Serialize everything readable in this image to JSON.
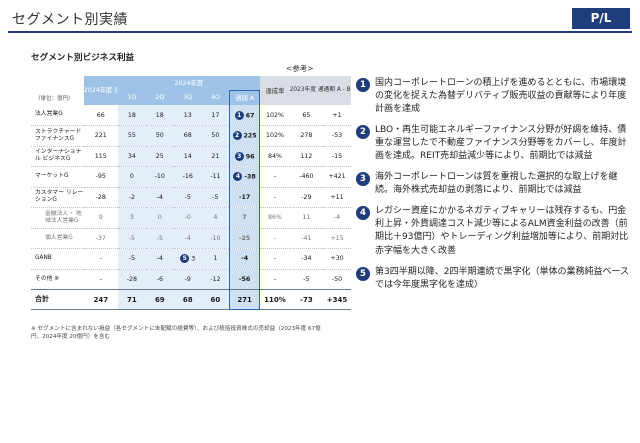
{
  "header": {
    "title": "セグメント別実績",
    "badge": "P/L"
  },
  "section_title": "セグメント別ビジネス利益",
  "ref_label": "<参考>",
  "table": {
    "unit_label": "（単位：億円）",
    "fy24_plan_header": "2024年度 計画",
    "fy24_header": "2024年度",
    "quarters": [
      "1Q",
      "2Q",
      "3Q",
      "4Q"
    ],
    "accum_header": "通期 A",
    "achieve_header": "達成率",
    "fy23_header": "2023年度 通期 B",
    "diff_header": "通期 A - B",
    "rows": [
      {
        "name": "法人営業G",
        "plan": "66",
        "q1": "18",
        "q2": "18",
        "q3": "13",
        "q4": "17",
        "badge": "1",
        "accum": "67",
        "rate": "102%",
        "fy23": "65",
        "diff": "+1"
      },
      {
        "name": "ストラクチャード ファイナンスG",
        "plan": "221",
        "q1": "55",
        "q2": "50",
        "q3": "68",
        "q4": "50",
        "badge": "2",
        "accum": "225",
        "rate": "102%",
        "fy23": "278",
        "diff": "-53"
      },
      {
        "name": "インターナショナル ビジネスG",
        "plan": "115",
        "q1": "34",
        "q2": "25",
        "q3": "14",
        "q4": "21",
        "badge": "3",
        "accum": "96",
        "rate": "84%",
        "fy23": "112",
        "diff": "-15"
      },
      {
        "name": "マーケットG",
        "plan": "-95",
        "q1": "0",
        "q2": "-10",
        "q3": "-16",
        "q4": "-11",
        "badge": "4",
        "accum": "-38",
        "rate": "-",
        "fy23": "-460",
        "diff": "+421"
      },
      {
        "name": "カスタマー リレーションG",
        "plan": "-28",
        "q1": "-2",
        "q2": "-4",
        "q3": "-5",
        "q4": "-5",
        "badge": "",
        "accum": "-17",
        "rate": "-",
        "fy23": "-29",
        "diff": "+11"
      },
      {
        "name": "金融法人・ 地域法人営業G",
        "plan": "9",
        "q1": "3",
        "q2": "0",
        "q3": "-0",
        "q4": "4",
        "badge": "",
        "accum": "7",
        "rate": "86%",
        "fy23": "11",
        "diff": "-4",
        "sub": true
      },
      {
        "name": "個人営業G",
        "plan": "-37",
        "q1": "-5",
        "q2": "-5",
        "q3": "-4",
        "q4": "-10",
        "badge": "",
        "accum": "-25",
        "rate": "-",
        "fy23": "-41",
        "diff": "+15",
        "sub": true
      },
      {
        "name": "GANB",
        "plan": "-",
        "q1": "-5",
        "q2": "-4",
        "q3": "3",
        "q3_badge": "5",
        "q4": "1",
        "badge": "",
        "accum": "-4",
        "rate": "-",
        "fy23": "-34",
        "diff": "+30"
      },
      {
        "name": "その他 ※",
        "plan": "-",
        "q1": "-28",
        "q2": "-6",
        "q3": "-9",
        "q4": "-12",
        "badge": "",
        "accum": "-56",
        "rate": "-",
        "fy23": "-5",
        "diff": "-50"
      }
    ],
    "total": {
      "name": "合計",
      "plan": "247",
      "q1": "71",
      "q2": "69",
      "q3": "68",
      "q4": "60",
      "accum": "271",
      "rate": "110%",
      "fy23": "-73",
      "diff": "+345"
    }
  },
  "footnote": "※ セグメントに含まれない損益（各セグメントに未配賦の経費等）、および統括投資株式の売却益（2023年度 67億円、2024年度 20億円）を含む",
  "notes": [
    {
      "num": "1",
      "text": "国内コーポレートローンの積上げを進めるとともに、市場環境の変化を捉えた為替デリバティブ販売収益の貢献等により年度計画を達成"
    },
    {
      "num": "2",
      "text": "LBO・再生可能エネルギーファイナンス分野が好調を維持、債重な運営したで不動産ファイナンス分野等をカバーし、年度計画を達成。REIT売却益減少等により、前期比では減益"
    },
    {
      "num": "3",
      "text": "海外コーポレートローンは質を重視した選択的な取上げを継続。海外株式売却益の剥落により、前期比では減益"
    },
    {
      "num": "4",
      "text": "レガシー資産にかかるネガティブキャリーは残存するも、円金利上昇・外貨調達コスト減少等によるALM資金利益の改善（前期比＋93億円）やトレーディング利益増加等により、前期対比赤字幅を大きく改善"
    },
    {
      "num": "5",
      "text": "第3四半期以降、2四半期連続で黒字化（単体の業務純益ベースでは今年度黒字化を達成）"
    }
  ]
}
